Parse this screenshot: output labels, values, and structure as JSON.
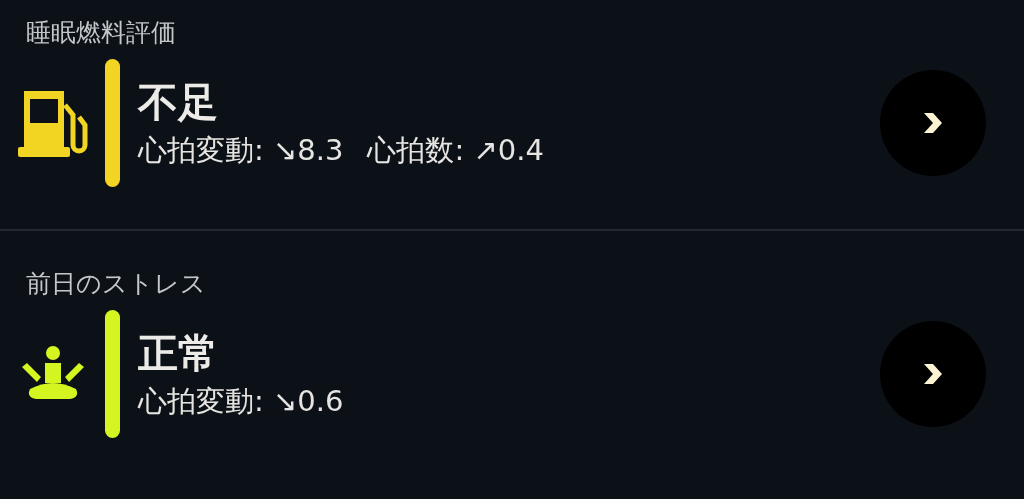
{
  "sections": [
    {
      "title": "睡眠燃料評価",
      "kind": "fuel",
      "color": "#f2d422",
      "status": "不足",
      "metrics": [
        "心拍変動: ↘8.3",
        "心拍数: ↗0.4"
      ]
    },
    {
      "title": "前日のストレス",
      "kind": "meditation",
      "color": "#d4f520",
      "status": "正常",
      "metrics": [
        "心拍変動: ↘0.6"
      ]
    }
  ]
}
